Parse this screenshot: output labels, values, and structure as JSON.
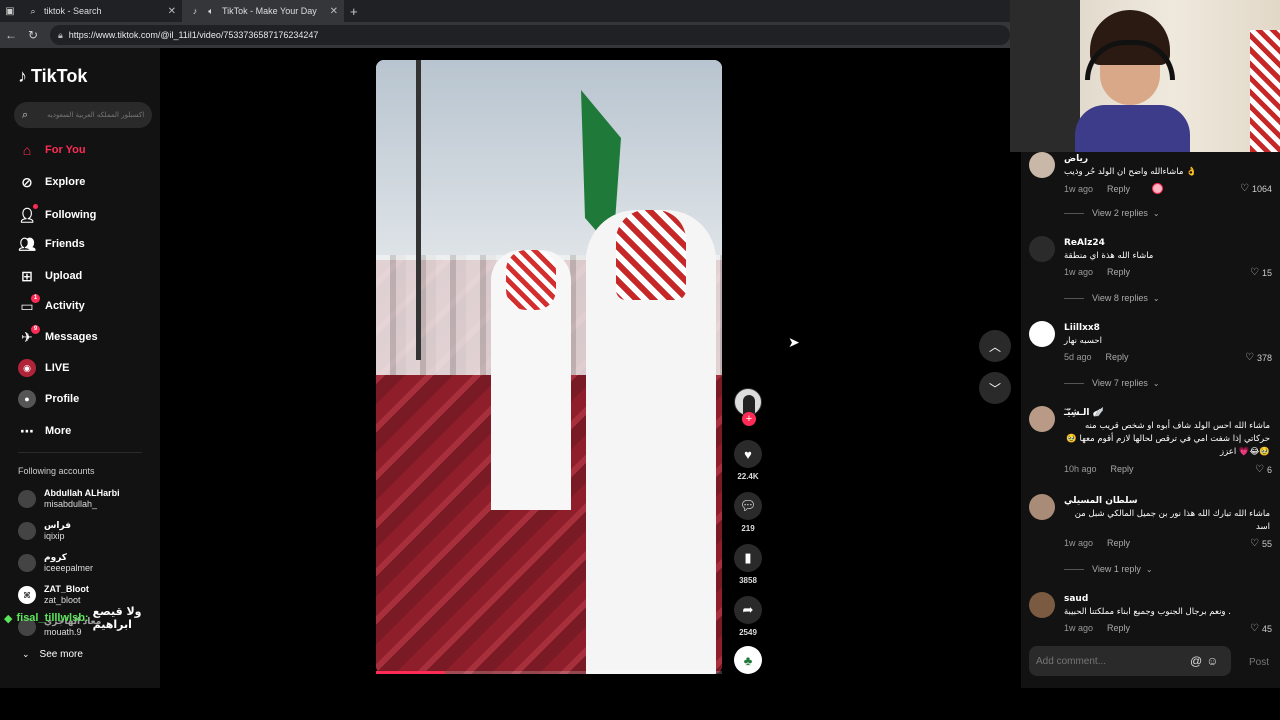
{
  "browser": {
    "tabs": [
      {
        "title": "tiktok - Search",
        "icon": "search-icon",
        "active": false
      },
      {
        "title": "TikTok - Make Your Day",
        "icon": "tiktok-icon",
        "active": true
      }
    ],
    "url": "https://www.tiktok.com/@il_11il1/video/7533736587176234247"
  },
  "sidebar": {
    "logo": "TikTok",
    "search_placeholder": "اكسبلور المملكه العربية السعوديه",
    "nav": [
      {
        "label": "For You",
        "icon": "home-icon",
        "active": true
      },
      {
        "label": "Explore",
        "icon": "compass-icon"
      },
      {
        "label": "Following",
        "icon": "following-icon"
      },
      {
        "label": "Friends",
        "icon": "friends-icon"
      },
      {
        "label": "Upload",
        "icon": "upload-icon"
      },
      {
        "label": "Activity",
        "icon": "activity-icon",
        "badge": "1"
      },
      {
        "label": "Messages",
        "icon": "messages-icon",
        "badge": "9"
      },
      {
        "label": "LIVE",
        "icon": "live-icon"
      },
      {
        "label": "Profile",
        "icon": "profile-icon"
      },
      {
        "label": "More",
        "icon": "more-icon"
      }
    ],
    "following_title": "Following accounts",
    "accounts": [
      {
        "name": "Abdullah ALHarbi",
        "handle": "misabdullah_"
      },
      {
        "name": "فراس",
        "handle": "iqixip"
      },
      {
        "name": "كروم",
        "handle": "iceeepalmer"
      },
      {
        "name": "ZAT_Bloot",
        "handle": "zat_bloot"
      },
      {
        "name": "معاذ الهاجري",
        "handle": "mouath.9"
      }
    ],
    "see_more": "See more"
  },
  "chat_overlay": {
    "user": "fisal_tilllwlsb:",
    "message": "ولا قيصع ابراهيم"
  },
  "video": {
    "progress": 0.2,
    "likes": "22.4K",
    "comments": "219",
    "saves": "3858",
    "shares": "2549"
  },
  "comments": [
    {
      "name": "رياض",
      "text": "ماشاءالله واضح ان الولد حُر وذيب 👌",
      "time": "1w ago",
      "reply": "Reply",
      "likes": "1064",
      "view_replies": "View 2 replies",
      "creator_liked": true
    },
    {
      "name": "ReAlz24",
      "text": "ماشاء الله هذة اي منطقة",
      "time": "1w ago",
      "reply": "Reply",
      "likes": "15",
      "view_replies": "View 8 replies"
    },
    {
      "name": "Liillxx8",
      "text": "احسبه نهار",
      "time": "5d ago",
      "reply": "Reply",
      "likes": "378",
      "view_replies": "View 7 replies"
    },
    {
      "name": "الـشِيّـٓ 🪽",
      "text": "ماشاء الله احس الولد شاف أبوه او شخص قريب منه حركاتي إذا شفت امي في ترقص لحالها لازم أقوم معها 🥹🥹😂💗 اعزز",
      "time": "10h ago",
      "reply": "Reply",
      "likes": "6"
    },
    {
      "name": "سلطان المسيلي",
      "text": "ماشاء الله تبارك الله هذا نور بن جميل المالكي شبل من اسد",
      "time": "1w ago",
      "reply": "Reply",
      "likes": "55",
      "view_replies": "View 1 reply"
    },
    {
      "name": "saud",
      "text": "ونعم برجال الجنوب وجميع ابناء مملكتنا الحبيبة .",
      "time": "1w ago",
      "reply": "Reply",
      "likes": "45"
    }
  ],
  "comment_input": {
    "placeholder": "Add comment...",
    "post": "Post"
  }
}
